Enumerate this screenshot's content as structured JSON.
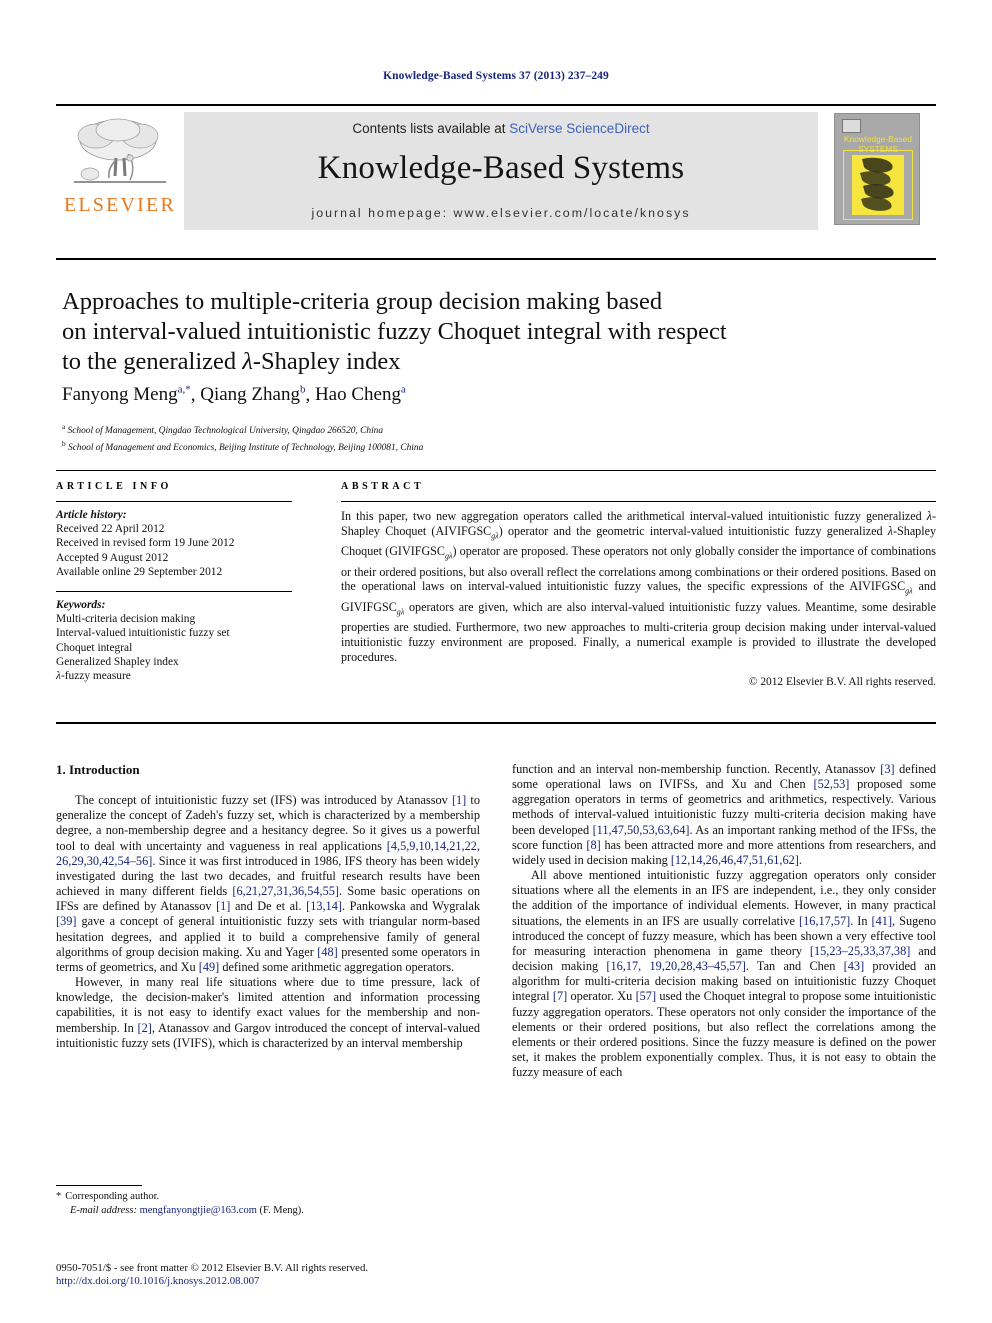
{
  "running_head": "Knowledge-Based Systems 37 (2013) 237–249",
  "masthead": {
    "publisher_name": "ELSEVIER",
    "contents_prefix": "Contents lists available at ",
    "contents_link": "SciVerse ScienceDirect",
    "journal_name": "Knowledge-Based Systems",
    "homepage": "journal homepage: www.elsevier.com/locate/knosys",
    "cover": {
      "line1": "Knowledge-Based",
      "line2": "SYSTEMS"
    }
  },
  "article": {
    "title_line1": "Approaches to multiple-criteria group decision making based",
    "title_line2": "on interval-valued intuitionistic fuzzy Choquet integral with respect",
    "title_line3": "to the generalized λ-Shapley index",
    "authors": "Fanyong Meng, Qiang Zhang, Hao Cheng",
    "affiliation_a": "School of Management, Qingdao Technological University, Qingdao 266520, China",
    "affiliation_b": "School of Management and Economics, Beijing Institute of Technology, Beijing 100081, China"
  },
  "info": {
    "heading": "ARTICLE INFO",
    "history_label": "Article history:",
    "history": [
      "Received 22 April 2012",
      "Received in revised form 19 June 2012",
      "Accepted 9 August 2012",
      "Available online 29 September 2012"
    ],
    "keywords_label": "Keywords:",
    "keywords": [
      "Multi-criteria decision making",
      "Interval-valued intuitionistic fuzzy set",
      "Choquet integral",
      "Generalized Shapley index",
      "λ-fuzzy measure"
    ]
  },
  "abstract": {
    "heading": "ABSTRACT",
    "text": "In this paper, two new aggregation operators called the arithmetical interval-valued intuitionistic fuzzy generalized λ-Shapley Choquet (AIVIFGSCgλ) operator and the geometric interval-valued intuitionistic fuzzy generalized λ-Shapley Choquet (GIVIFGSCgλ) operator are proposed. These operators not only globally consider the importance of combinations or their ordered positions, but also overall reflect the correlations among combinations or their ordered positions. Based on the operational laws on interval-valued intuitionistic fuzzy values, the specific expressions of the AIVIFGSCgλ and GIVIFGSCgλ operators are given, which are also interval-valued intuitionistic fuzzy values. Meantime, some desirable properties are studied. Furthermore, two new approaches to multi-criteria group decision making under interval-valued intuitionistic fuzzy environment are proposed. Finally, a numerical example is provided to illustrate the developed procedures.",
    "copyright": "© 2012 Elsevier B.V. All rights reserved."
  },
  "body": {
    "section_heading": "1. Introduction",
    "left_paragraphs": [
      "The concept of intuitionistic fuzzy set (IFS) was introduced by Atanassov [1] to generalize the concept of Zadeh's fuzzy set, which is characterized by a membership degree, a non-membership degree and a hesitancy degree. So it gives us a powerful tool to deal with uncertainty and vagueness in real applications [4,5,9,10,14,21,22, 26,29,30,42,54–56]. Since it was first introduced in 1986, IFS theory has been widely investigated during the last two decades, and fruitful research results have been achieved in many different fields [6,21,27,31,36,54,55]. Some basic operations on IFSs are defined by Atanassov [1] and De et al. [13,14]. Pankowska and Wygralak [39] gave a concept of general intuitionistic fuzzy sets with triangular norm-based hesitation degrees, and applied it to build a comprehensive family of general algorithms of group decision making. Xu and Yager [48] presented some operators in terms of geometrics, and Xu [49] defined some arithmetic aggregation operators.",
      "However, in many real life situations where due to time pressure, lack of knowledge, the decision-maker's limited attention and information processing capabilities, it is not easy to identify exact values for the membership and non-membership. In [2], Atanassov and Gargov introduced the concept of interval-valued intuitionistic fuzzy sets (IVIFS), which is characterized by an interval membership"
    ],
    "right_paragraphs": [
      "function and an interval non-membership function. Recently, Atanassov [3] defined some operational laws on IVIFSs, and Xu and Chen [52,53] proposed some aggregation operators in terms of geometrics and arithmetics, respectively. Various methods of interval-valued intuitionistic fuzzy multi-criteria decision making have been developed [11,47,50,53,63,64]. As an important ranking method of the IFSs, the score function [8] has been attracted more and more attentions from researchers, and widely used in decision making [12,14,26,46,47,51,61,62].",
      "All above mentioned intuitionistic fuzzy aggregation operators only consider situations where all the elements in an IFS are independent, i.e., they only consider the addition of the importance of individual elements. However, in many practical situations, the elements in an IFS are usually correlative [16,17,57]. In [41], Sugeno introduced the concept of fuzzy measure, which has been shown a very effective tool for measuring interaction phenomena in game theory [15,23–25,33,37,38] and decision making [16,17, 19,20,28,43–45,57]. Tan and Chen [43] provided an algorithm for multi-criteria decision making based on intuitionistic fuzzy Choquet integral [7] operator. Xu [57] used the Choquet integral to propose some intuitionistic fuzzy aggregation operators. These operators not only consider the importance of the elements or their ordered positions, but also reflect the correlations among the elements or their ordered positions. Since the fuzzy measure is defined on the power set, it makes the problem exponentially complex. Thus, it is not easy to obtain the fuzzy measure of each"
    ]
  },
  "footnote": {
    "corresponding": "Corresponding author.",
    "email_label": "E-mail address:",
    "email": "mengfanyongtjie@163.com",
    "email_suffix": "(F. Meng)."
  },
  "footer": {
    "issn_line": "0950-7051/$ - see front matter © 2012 Elsevier B.V. All rights reserved.",
    "doi": "http://dx.doi.org/10.1016/j.knosys.2012.08.007"
  },
  "colors": {
    "link": "#16237a",
    "sciencedirect_link": "#3b63b8",
    "elsevier_orange": "#e87722",
    "banner_gray": "#e3e3e3",
    "cover_yellow": "#f2e23d"
  }
}
